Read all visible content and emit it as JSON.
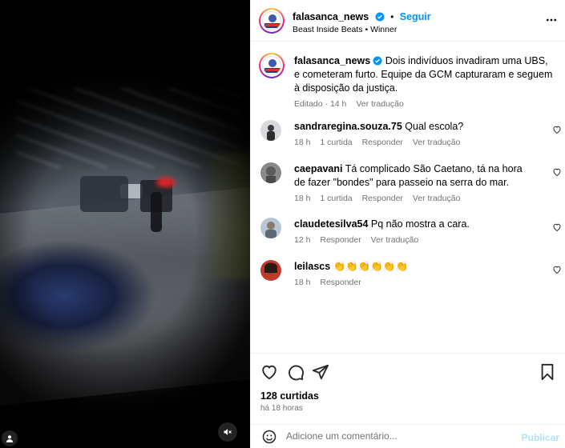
{
  "header": {
    "username": "falasanca_news",
    "follow_label": "Seguir",
    "separator": "•",
    "subtitle": "Beast Inside Beats • Winner"
  },
  "caption": {
    "username": "falasanca_news",
    "text": "Dois indivíduos invadiram uma UBS, e cometeram furto. Equipe da GCM capturaram e seguem à disposição da justiça.",
    "edited": "Editado · 14 h",
    "translate": "Ver tradução"
  },
  "comments": [
    {
      "username": "sandraregina.souza.75",
      "text": "Qual escola?",
      "time": "18 h",
      "likes": "1 curtida",
      "reply": "Responder",
      "translate": "Ver tradução"
    },
    {
      "username": "caepavani",
      "text": "Tá complicado São Caetano, tá na hora de fazer \"bondes\" para passeio na serra do mar.",
      "time": "18 h",
      "likes": "1 curtida",
      "reply": "Responder",
      "translate": "Ver tradução"
    },
    {
      "username": "claudetesilva54",
      "text": "Pq não mostra a cara.",
      "time": "12 h",
      "reply": "Responder",
      "translate": "Ver tradução"
    },
    {
      "username": "leilascs",
      "text": "👏👏👏👏👏👏",
      "time": "18 h",
      "reply": "Responder"
    }
  ],
  "footer": {
    "likes": "128 curtidas",
    "time_ago": "há 18 horas",
    "add_comment_placeholder": "Adicione um comentário...",
    "post_label": "Publicar"
  },
  "icons": {
    "verified": "verified-badge-icon",
    "more": "more-options-icon",
    "heart": "heart-icon",
    "comment": "comment-icon",
    "share": "share-icon",
    "save": "bookmark-icon",
    "emoji": "emoji-icon",
    "mute": "muted-speaker-icon",
    "user_tag": "user-tag-icon"
  },
  "colors": {
    "accent": "#0095f6",
    "muted": "#737373",
    "post_disabled": "#b2dffc"
  }
}
